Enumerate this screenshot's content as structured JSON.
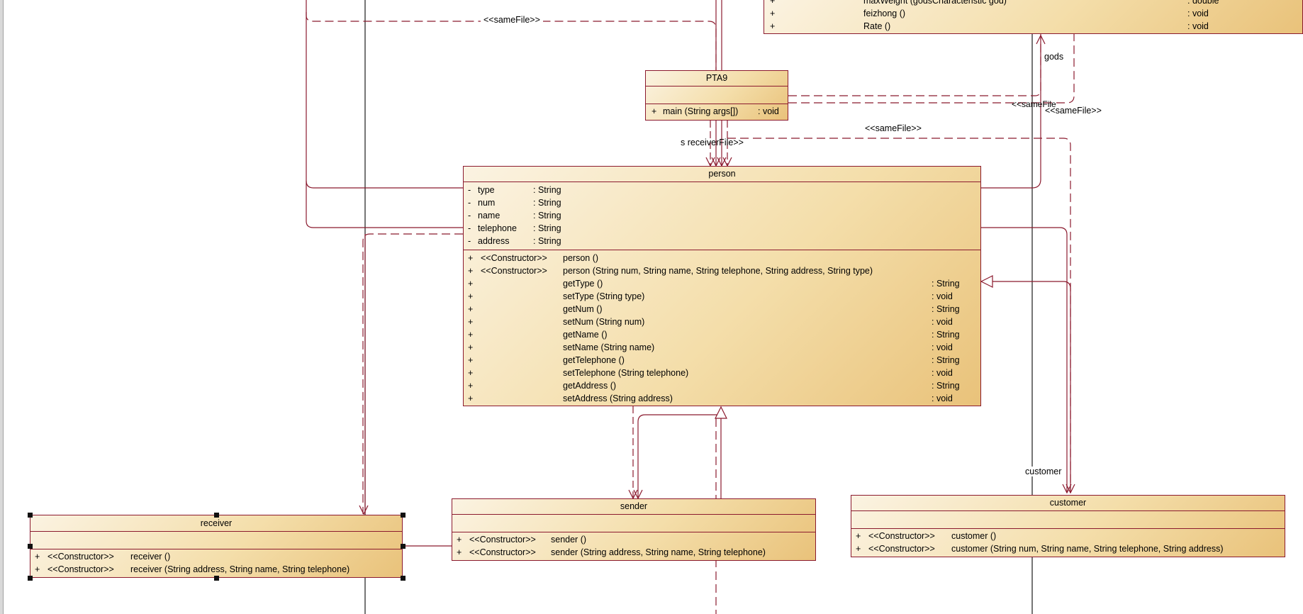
{
  "classes": {
    "top": {
      "attributes": [
        {
          "vis": "+",
          "name": "maxWeight (godsCharacteristic god)",
          "type": ": double"
        },
        {
          "vis": "+",
          "name": "feizhong ()",
          "type": ": void"
        },
        {
          "vis": "+",
          "name": "Rate ()",
          "type": ": void"
        }
      ]
    },
    "pta9": {
      "name": "PTA9",
      "methods": [
        {
          "vis": "+",
          "name": "main (String args[])",
          "type": ": void"
        }
      ]
    },
    "person": {
      "name": "person",
      "attributes": [
        {
          "vis": "-",
          "name": "type",
          "type": ": String"
        },
        {
          "vis": "-",
          "name": "num",
          "type": ": String"
        },
        {
          "vis": "-",
          "name": "name",
          "type": ": String"
        },
        {
          "vis": "-",
          "name": "telephone",
          "type": ": String"
        },
        {
          "vis": "-",
          "name": "address",
          "type": ": String"
        }
      ],
      "methods": [
        {
          "vis": "+",
          "stereo": "<<Constructor>>",
          "name": "person ()",
          "type": ""
        },
        {
          "vis": "+",
          "stereo": "<<Constructor>>",
          "name": "person (String num, String name, String telephone, String address, String type)",
          "type": ""
        },
        {
          "vis": "+",
          "stereo": "",
          "name": "getType ()",
          "type": ": String"
        },
        {
          "vis": "+",
          "stereo": "",
          "name": "setType (String type)",
          "type": ": void"
        },
        {
          "vis": "+",
          "stereo": "",
          "name": "getNum ()",
          "type": ": String"
        },
        {
          "vis": "+",
          "stereo": "",
          "name": "setNum (String num)",
          "type": ": void"
        },
        {
          "vis": "+",
          "stereo": "",
          "name": "getName ()",
          "type": ": String"
        },
        {
          "vis": "+",
          "stereo": "",
          "name": "setName (String name)",
          "type": ": void"
        },
        {
          "vis": "+",
          "stereo": "",
          "name": "getTelephone ()",
          "type": ": String"
        },
        {
          "vis": "+",
          "stereo": "",
          "name": "setTelephone (String telephone)",
          "type": ": void"
        },
        {
          "vis": "+",
          "stereo": "",
          "name": "getAddress ()",
          "type": ": String"
        },
        {
          "vis": "+",
          "stereo": "",
          "name": "setAddress (String address)",
          "type": ": void"
        }
      ]
    },
    "receiver": {
      "name": "receiver",
      "methods": [
        {
          "vis": "+",
          "stereo": "<<Constructor>>",
          "name": "receiver ()"
        },
        {
          "vis": "+",
          "stereo": "<<Constructor>>",
          "name": "receiver (String address, String name, String telephone)"
        }
      ]
    },
    "sender": {
      "name": "sender",
      "methods": [
        {
          "vis": "+",
          "stereo": "<<Constructor>>",
          "name": "sender ()"
        },
        {
          "vis": "+",
          "stereo": "<<Constructor>>",
          "name": "sender (String address, String name, String telephone)"
        }
      ]
    },
    "customer": {
      "name": "customer",
      "methods": [
        {
          "vis": "+",
          "stereo": "<<Constructor>>",
          "name": "customer ()"
        },
        {
          "vis": "+",
          "stereo": "<<Constructor>>",
          "name": "customer (String num, String name, String telephone, String address)"
        }
      ]
    }
  },
  "labels": {
    "samefile_top": "<<sameFile>>",
    "gods": "gods",
    "samefile_right1": "<<sameFile",
    "samefile_right2": "<<sameFile>>",
    "samefile_mid": "<<sameFile>>",
    "receiver_overlap": "s receiverFile>>",
    "customer_role": "customer"
  },
  "colors": {
    "line": "#8b1a2e",
    "box_light": "#fbf3e2",
    "box_dark": "#e9c27a",
    "black_line": "#1a1a1a"
  }
}
